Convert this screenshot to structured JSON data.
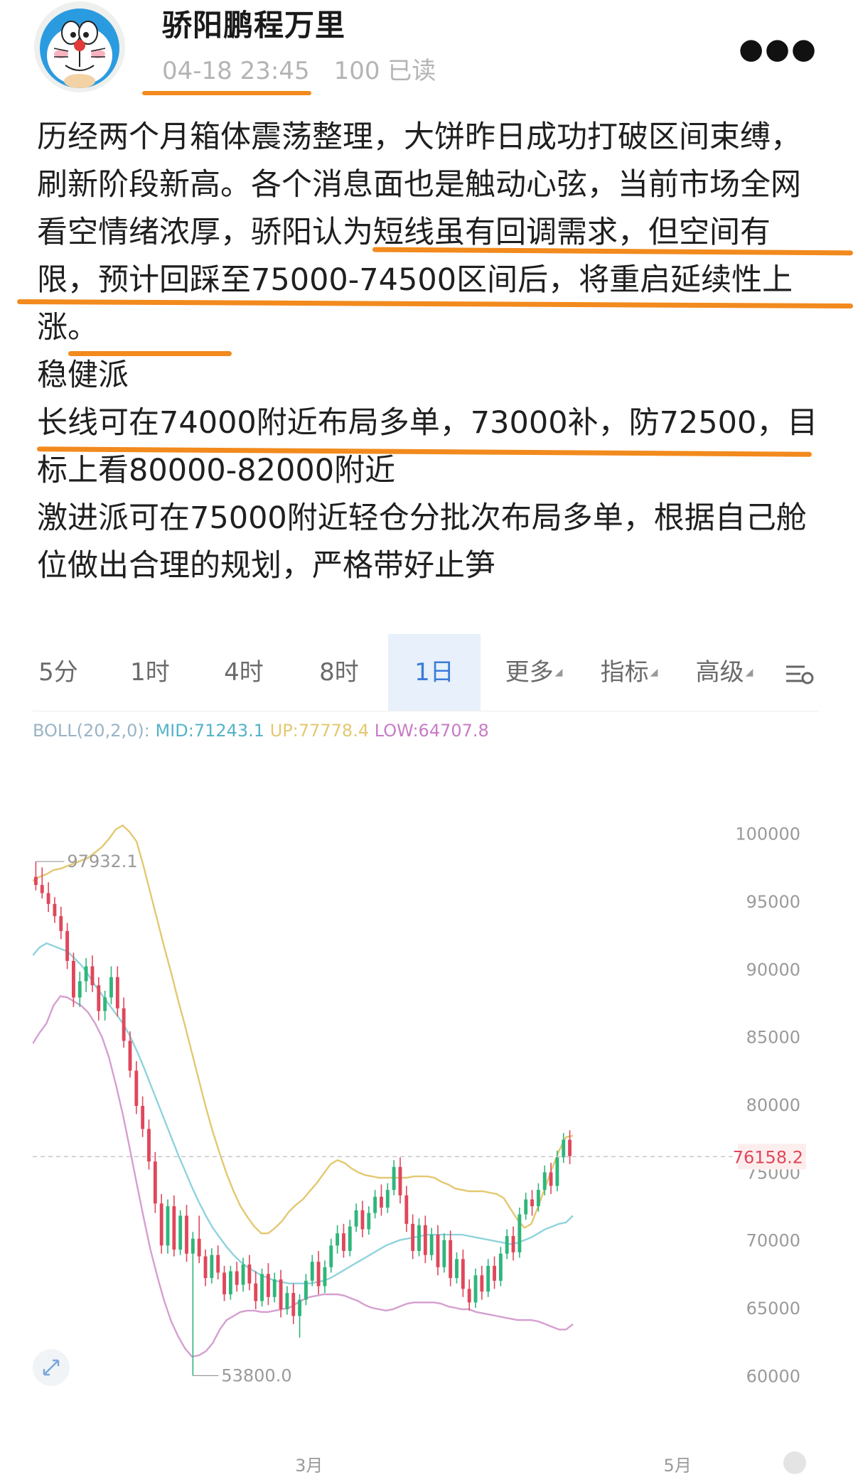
{
  "post": {
    "author": "骄阳鹏程万里",
    "time": "04-18 23:45",
    "reads": "100 已读",
    "more_icon": "more-dots-icon",
    "paragraphs": [
      "历经两个月箱体震荡整理，大饼昨日成功打破区间束缚，刷新阶段新高。各个消息面也是触动心弦，当前市场全网看空情绪浓厚，骄阳认为短线虽有回调需求，但空间有限，预计回踩至75000-74500区间后，将重启延续性上涨。",
      "稳健派",
      "长线可在74000附近布局多单，73000补，防72500，目标上看80000-82000附近",
      "激进派可在75000附近轻仓分批次布局多单，根据自己舱位做出合理的规划，严格带好止笋"
    ]
  },
  "chart": {
    "tabs": [
      {
        "label": "5分"
      },
      {
        "label": "1时"
      },
      {
        "label": "4时"
      },
      {
        "label": "8时"
      },
      {
        "label": "1日",
        "active": true
      },
      {
        "label": "更多"
      },
      {
        "label": "指标"
      },
      {
        "label": "高级"
      }
    ],
    "settings_icon": "settings-icon",
    "expand_icon": "expand-icon",
    "boll": {
      "name": "BOLL(20,2,0):",
      "mid": "MID:71243.1",
      "up": "UP:77778.4",
      "low": "LOW:64707.8"
    },
    "colors": {
      "up": "#2fb67a",
      "down": "#e0475b",
      "upper": "#e3c871",
      "mid": "#8fd3dc",
      "lower": "#d59fd0"
    }
  },
  "chart_data": {
    "type": "candlestick",
    "indicator": "BOLL(20,2,0)",
    "y_ticks": [
      "100000",
      "95000",
      "90000",
      "85000",
      "80000",
      "75000",
      "70000",
      "65000",
      "60000"
    ],
    "ylim": [
      58500,
      101500
    ],
    "x_ticks": [
      "3月",
      "5月"
    ],
    "current_price": "76158.2",
    "annotations": {
      "high": "97932.1",
      "low": "53800.0"
    },
    "candles": [
      [
        96800,
        97932,
        95800,
        96200
      ],
      [
        96200,
        97500,
        95200,
        95600
      ],
      [
        95600,
        96400,
        94200,
        94800
      ],
      [
        94800,
        95300,
        93400,
        93900
      ],
      [
        93900,
        94600,
        92200,
        92800
      ],
      [
        92800,
        93400,
        90000,
        90600
      ],
      [
        90600,
        91200,
        87200,
        87900
      ],
      [
        87900,
        89800,
        87200,
        89100
      ],
      [
        89100,
        90800,
        88300,
        90200
      ],
      [
        90200,
        91000,
        88300,
        88800
      ],
      [
        88800,
        89400,
        86200,
        86900
      ],
      [
        86900,
        88400,
        86200,
        87900
      ],
      [
        87900,
        90200,
        87400,
        89400
      ],
      [
        89400,
        90200,
        86500,
        87100
      ],
      [
        87100,
        87900,
        84200,
        84700
      ],
      [
        84700,
        85400,
        82000,
        82500
      ],
      [
        82500,
        83200,
        79300,
        79900
      ],
      [
        79900,
        80600,
        77600,
        78200
      ],
      [
        78200,
        78900,
        75200,
        75800
      ],
      [
        75800,
        76500,
        72000,
        72700
      ],
      [
        72700,
        73400,
        69000,
        69600
      ],
      [
        69600,
        73000,
        69000,
        72500
      ],
      [
        72500,
        73300,
        68800,
        69300
      ],
      [
        69300,
        72200,
        68900,
        71800
      ],
      [
        71800,
        72600,
        68400,
        69000
      ],
      [
        69000,
        70600,
        60000,
        70100
      ],
      [
        70100,
        71800,
        68300,
        68800
      ],
      [
        68800,
        69300,
        66600,
        67200
      ],
      [
        67200,
        69400,
        66800,
        68900
      ],
      [
        68900,
        69600,
        67100,
        67600
      ],
      [
        67600,
        68100,
        65500,
        66000
      ],
      [
        66000,
        68100,
        65600,
        67700
      ],
      [
        67700,
        68400,
        66200,
        66700
      ],
      [
        66700,
        68700,
        66200,
        68200
      ],
      [
        68200,
        68900,
        66300,
        66800
      ],
      [
        66800,
        67700,
        64900,
        65500
      ],
      [
        65500,
        67900,
        65100,
        67500
      ],
      [
        67500,
        68300,
        65200,
        65800
      ],
      [
        65800,
        67600,
        65400,
        67100
      ],
      [
        67100,
        67800,
        64300,
        64900
      ],
      [
        64900,
        66600,
        64500,
        66100
      ],
      [
        66100,
        66800,
        63800,
        64400
      ],
      [
        64400,
        66000,
        62800,
        65600
      ],
      [
        65600,
        67500,
        65200,
        67000
      ],
      [
        67000,
        68900,
        66600,
        68400
      ],
      [
        68400,
        69200,
        66000,
        66600
      ],
      [
        66600,
        68500,
        66100,
        68000
      ],
      [
        68000,
        70100,
        67600,
        69600
      ],
      [
        69600,
        71100,
        69000,
        70500
      ],
      [
        70500,
        71200,
        68700,
        69200
      ],
      [
        69200,
        71500,
        68800,
        71000
      ],
      [
        71000,
        72700,
        70600,
        72200
      ],
      [
        72200,
        72900,
        70200,
        70800
      ],
      [
        70800,
        72500,
        70400,
        72000
      ],
      [
        72000,
        73700,
        71600,
        73200
      ],
      [
        73200,
        74100,
        71800,
        72400
      ],
      [
        72400,
        74200,
        72000,
        73700
      ],
      [
        73700,
        75900,
        73300,
        75400
      ],
      [
        75400,
        76100,
        72700,
        73300
      ],
      [
        73300,
        74000,
        70600,
        71200
      ],
      [
        71200,
        71900,
        68600,
        69200
      ],
      [
        69200,
        71600,
        68800,
        71100
      ],
      [
        71100,
        71800,
        68300,
        68900
      ],
      [
        68900,
        70900,
        68500,
        70400
      ],
      [
        70400,
        71100,
        67400,
        68000
      ],
      [
        68000,
        70500,
        67600,
        70000
      ],
      [
        70000,
        70700,
        66600,
        67200
      ],
      [
        67200,
        69100,
        66800,
        68600
      ],
      [
        68600,
        69300,
        65800,
        66400
      ],
      [
        66400,
        67100,
        64800,
        65400
      ],
      [
        65400,
        67900,
        65000,
        67400
      ],
      [
        67400,
        68100,
        65600,
        66200
      ],
      [
        66200,
        68600,
        65800,
        68100
      ],
      [
        68100,
        68800,
        66400,
        67000
      ],
      [
        67000,
        69500,
        66600,
        69000
      ],
      [
        69000,
        70800,
        68600,
        70300
      ],
      [
        70300,
        71000,
        68500,
        69100
      ],
      [
        69100,
        72400,
        68700,
        71900
      ],
      [
        71900,
        73500,
        71500,
        73000
      ],
      [
        73000,
        73700,
        71800,
        72500
      ],
      [
        72500,
        74200,
        72100,
        73700
      ],
      [
        73700,
        75500,
        73300,
        75000
      ],
      [
        75000,
        75700,
        73400,
        74000
      ],
      [
        74000,
        76600,
        73600,
        76100
      ],
      [
        76100,
        77900,
        75700,
        77400
      ],
      [
        77400,
        78100,
        75600,
        76200
      ]
    ],
    "series": [
      {
        "name": "UP",
        "values": [
          96500,
          96800,
          97000,
          97300,
          97400,
          97600,
          97800,
          98000,
          98200,
          98600,
          99000,
          99600,
          100300,
          100600,
          100100,
          99400,
          97600,
          95600,
          93600,
          91600,
          89700,
          87700,
          85800,
          83800,
          81800,
          79800,
          78000,
          76400,
          74900,
          73600,
          72500,
          71700,
          71000,
          70500,
          70500,
          70900,
          71400,
          72100,
          72600,
          73000,
          73600,
          74200,
          74900,
          75600,
          75900,
          75700,
          75300,
          75000,
          74800,
          74700,
          74600,
          74600,
          74600,
          74600,
          74600,
          74700,
          74700,
          74700,
          74600,
          74300,
          74100,
          73800,
          73700,
          73600,
          73600,
          73600,
          73500,
          73400,
          73100,
          72300,
          71500,
          70900,
          71200,
          72500,
          73900,
          75300,
          76600,
          77600,
          77700
        ]
      },
      {
        "name": "MID",
        "values": [
          91000,
          91600,
          91900,
          91700,
          91500,
          91300,
          90800,
          90300,
          89600,
          88800,
          88100,
          87400,
          86700,
          86000,
          85100,
          84000,
          82800,
          81500,
          80200,
          78900,
          77600,
          76300,
          75100,
          73900,
          72800,
          71800,
          70900,
          70200,
          69500,
          68900,
          68400,
          68000,
          67700,
          67400,
          67200,
          67000,
          66900,
          66800,
          66800,
          66800,
          66800,
          66900,
          67000,
          67200,
          67500,
          67800,
          68100,
          68400,
          68700,
          69000,
          69300,
          69600,
          69800,
          70000,
          70100,
          70200,
          70300,
          70400,
          70400,
          70400,
          70400,
          70400,
          70400,
          70300,
          70200,
          70100,
          70000,
          69900,
          69800,
          69700,
          69800,
          70000,
          70200,
          70500,
          70800,
          71000,
          71200,
          71300,
          71800
        ]
      },
      {
        "name": "LOW",
        "values": [
          84500,
          85300,
          86000,
          87300,
          88000,
          87900,
          87600,
          87300,
          86800,
          86000,
          85000,
          83500,
          81500,
          79300,
          76800,
          74200,
          71700,
          69300,
          67300,
          65500,
          64000,
          62900,
          62000,
          61400,
          61500,
          61800,
          62400,
          63400,
          64100,
          64400,
          64700,
          64800,
          64800,
          64700,
          64700,
          64800,
          64900,
          65000,
          65300,
          65600,
          65800,
          65900,
          66000,
          66000,
          66000,
          65900,
          65700,
          65500,
          65200,
          65000,
          64900,
          64800,
          64900,
          65100,
          65300,
          65400,
          65400,
          65400,
          65400,
          65300,
          65100,
          65000,
          64900,
          64900,
          64700,
          64600,
          64500,
          64400,
          64300,
          64200,
          64100,
          64100,
          64100,
          64000,
          63800,
          63600,
          63400,
          63400,
          63800
        ]
      }
    ]
  }
}
